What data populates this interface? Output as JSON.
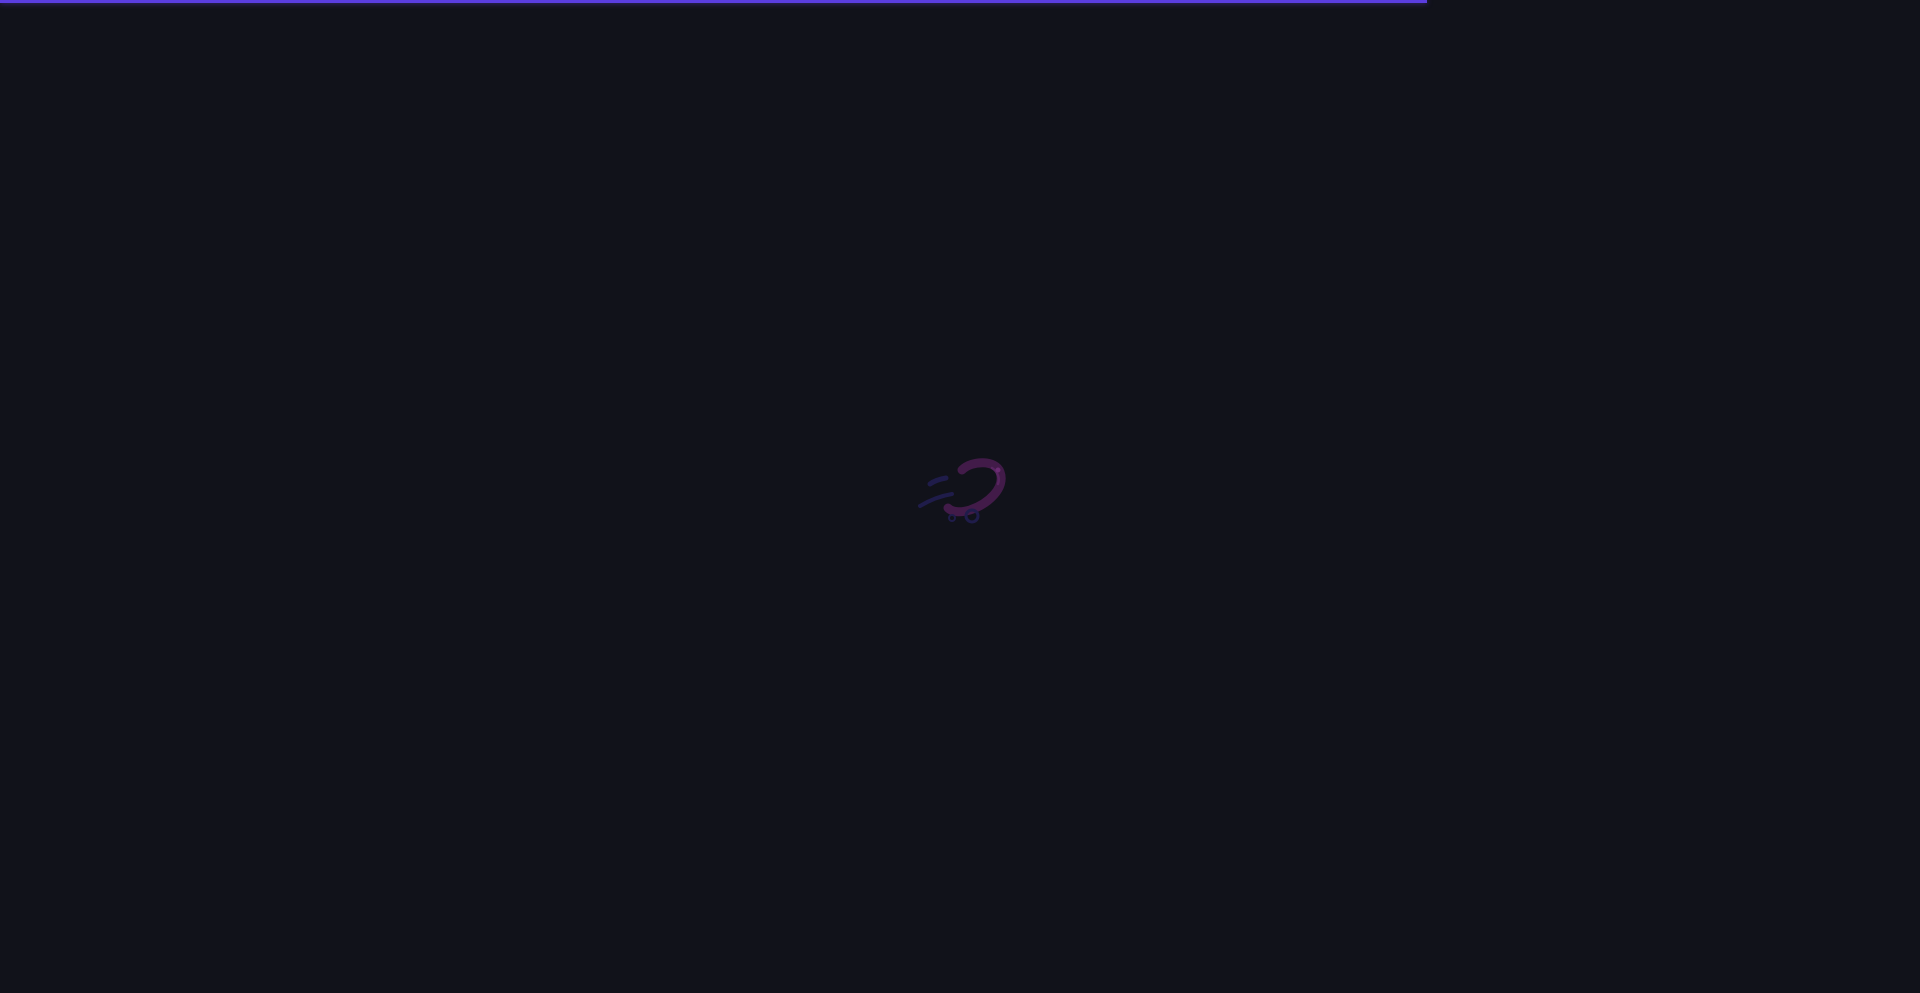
{
  "page_state": "loading",
  "loading_bar": {
    "progress": 0.743,
    "color": "#5b3de0"
  },
  "background_color": "#11121a",
  "logo": {
    "icon": "hook-logo-icon",
    "primary_color": "#4b1d52",
    "secondary_color": "#1f1c4a"
  }
}
